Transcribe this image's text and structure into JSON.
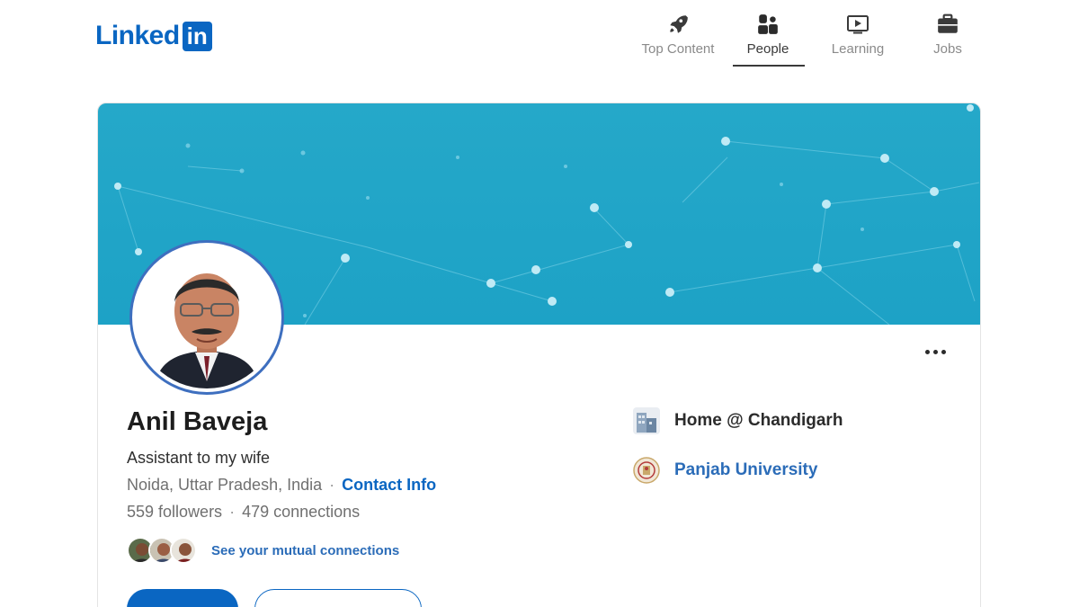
{
  "brand": {
    "logo_text": "Linked",
    "logo_badge": "in"
  },
  "nav": {
    "items": [
      {
        "label": "Top Content",
        "icon": "rocket-icon",
        "active": false
      },
      {
        "label": "People",
        "icon": "people-icon",
        "active": true
      },
      {
        "label": "Learning",
        "icon": "play-icon",
        "active": false
      },
      {
        "label": "Jobs",
        "icon": "briefcase-icon",
        "active": false
      }
    ]
  },
  "profile": {
    "name": "Anil Baveja",
    "headline": "Assistant to my wife",
    "location": "Noida, Uttar Pradesh, India",
    "contact_link": "Contact Info",
    "followers": "559 followers",
    "connections": "479 connections",
    "mutual_link": "See your mutual connections"
  },
  "side_info": {
    "current_position": "Home @ Chandigarh",
    "education": "Panjab University"
  },
  "colors": {
    "brand": "#0a66c2",
    "banner": "#1da2c6",
    "link": "#2b6cb8"
  }
}
